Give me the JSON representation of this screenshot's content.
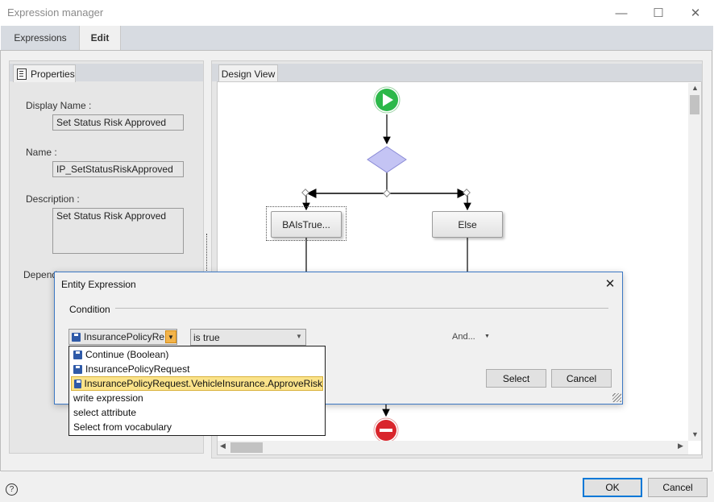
{
  "window": {
    "title": "Expression manager",
    "minimize_glyph": "—",
    "maximize_glyph": "☐",
    "close_glyph": "✕"
  },
  "tabs": [
    {
      "label": "Expressions"
    },
    {
      "label": "Edit"
    }
  ],
  "properties": {
    "tab_label": "Properties",
    "display_name_label": "Display Name :",
    "display_name_value": "Set Status Risk Approved",
    "name_label": "Name :",
    "name_value": "IP_SetStatusRiskApproved",
    "description_label": "Description :",
    "description_value": "Set Status Risk Approved",
    "dependencies_label_partial": "Depend"
  },
  "design_view": {
    "tab_label": "Design View",
    "node_true": "BAIsTrue...",
    "node_else": "Else"
  },
  "entity_dialog": {
    "title": "Entity Expression",
    "section": "Condition",
    "entity_combo_value": "InsurancePolicyRe",
    "operator_value": "is true",
    "and_label": "And...",
    "select_button": "Select",
    "cancel_button": "Cancel",
    "close_glyph": "✕"
  },
  "dropdown": {
    "items": [
      {
        "label": "Continue (Boolean)",
        "icon": "floppy-icon"
      },
      {
        "label": "InsurancePolicyRequest",
        "icon": "floppy-icon"
      },
      {
        "label": "InsurancePolicyRequest.VehicleInsurance.ApproveRisk",
        "icon": "floppy-icon"
      },
      {
        "label": "write expression"
      },
      {
        "label": "select attribute"
      },
      {
        "label": "Select from vocabulary"
      }
    ],
    "selected_index": 2
  },
  "footer": {
    "help_glyph": "?",
    "ok_button": "OK",
    "cancel_button": "Cancel"
  },
  "colors": {
    "accent": "#0078d7",
    "start_node": "#2db84a",
    "end_node": "#d9262c",
    "decision": "#b9b9f0",
    "selection_highlight": "#fbe38a"
  }
}
